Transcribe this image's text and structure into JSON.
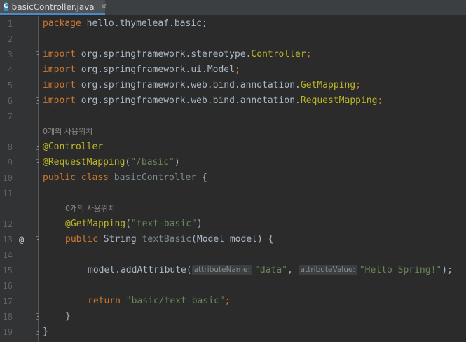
{
  "tab": {
    "label": "basicController.java",
    "icon": "java-class-icon",
    "icon_letter": "C",
    "close": "✕"
  },
  "line_numbers": [
    "1",
    "2",
    "3",
    "4",
    "5",
    "6",
    "7",
    "8",
    "9",
    "10",
    "11",
    "12",
    "13",
    "14",
    "15",
    "16",
    "17",
    "18",
    "19"
  ],
  "gutter_marker": "@",
  "usages_label": "0개의 사용위치",
  "code": {
    "l1_kw": "package",
    "l1_rest": " hello.thymeleaf.basic;",
    "import_kw": "import",
    "l3_pkg": " org.springframework.stereotype.",
    "l3_cls": "Controller",
    "l4_pkg": " org.springframework.ui.",
    "l4_cls": "Model",
    "l5_pkg": " org.springframework.web.bind.annotation.",
    "l5_cls": "GetMapping",
    "l6_pkg": " org.springframework.web.bind.annotation.",
    "l6_cls": "RequestMapping",
    "semi": ";",
    "l8_ann": "@Controller",
    "l9_ann": "@RequestMapping",
    "l9_str": "\"/basic\"",
    "l10_kw": "public class",
    "l10_name": "basicController",
    "l10_rest": " {",
    "l12_ann": "@GetMapping",
    "l12_str": "\"text-basic\"",
    "l13_kw": "public",
    "l13_type": " String ",
    "l13_name": "textBasic",
    "l13_rest": "(Model model) {",
    "l15_call": "model.addAttribute(",
    "l15_hint1": "attributeName:",
    "l15_str1": "\"data\"",
    "l15_comma": ", ",
    "l15_hint2": "attributeValue:",
    "l15_str2": "\"Hello Spring!\"",
    "l15_end": ");",
    "l17_kw": "return",
    "l17_str": "\"basic/text-basic\"",
    "close_brace": "}"
  }
}
